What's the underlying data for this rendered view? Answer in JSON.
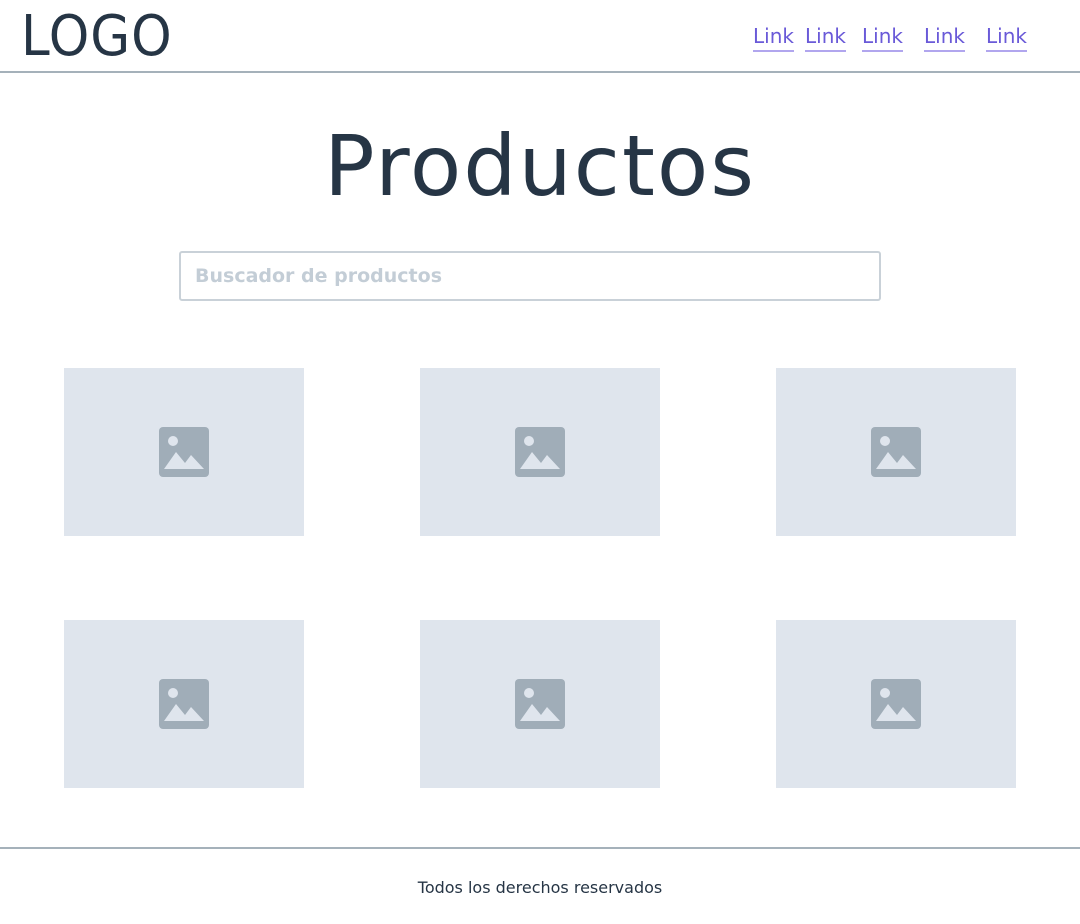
{
  "header": {
    "logo": "LOGO",
    "nav": [
      {
        "label": "Link"
      },
      {
        "label": "Link"
      },
      {
        "label": "Link"
      },
      {
        "label": "Link"
      },
      {
        "label": "Link"
      }
    ]
  },
  "main": {
    "title": "Productos",
    "search": {
      "placeholder": "Buscador de productos",
      "value": ""
    },
    "products": [
      {
        "icon": "image-placeholder-icon"
      },
      {
        "icon": "image-placeholder-icon"
      },
      {
        "icon": "image-placeholder-icon"
      },
      {
        "icon": "image-placeholder-icon"
      },
      {
        "icon": "image-placeholder-icon"
      },
      {
        "icon": "image-placeholder-icon"
      }
    ]
  },
  "footer": {
    "text": "Todos los derechos reservados"
  },
  "colors": {
    "text": "#263545",
    "link": "#6a5ad8",
    "placeholder_bg": "#dfe5ed",
    "placeholder_icon": "#a0adb8",
    "divider": "#a5b1ba"
  }
}
